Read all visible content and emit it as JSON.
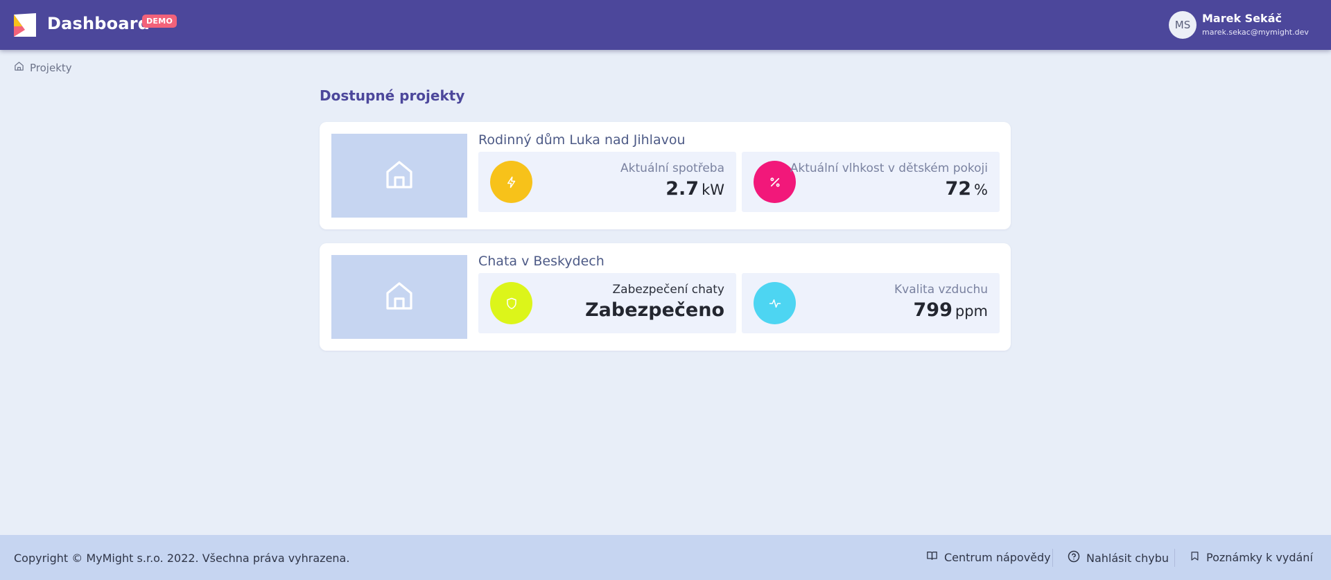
{
  "header": {
    "title": "Dashboard",
    "badge": "DEMO",
    "brand_color": "#4c479b",
    "user": {
      "initials": "MS",
      "name": "Marek Sekáč",
      "email": "marek.sekac@mymight.dev"
    }
  },
  "breadcrumb": {
    "icon": "home-icon",
    "label": "Projekty"
  },
  "main": {
    "title": "Dostupné projekty",
    "projects": [
      {
        "name": "Rodinný dům Luka nad Jihlavou",
        "image_icon": "house-icon",
        "metrics": [
          {
            "label": "Aktuální spotřeba",
            "value": "2.7",
            "unit": "kW",
            "icon": "lightning-icon",
            "color": "#f7c21a"
          },
          {
            "label": "Aktuální vlhkost v dětském pokoji",
            "value": "72",
            "unit": "%",
            "icon": "percent-icon",
            "color": "#f2187a"
          }
        ]
      },
      {
        "name": "Chata v Beskydech",
        "image_icon": "house-icon",
        "metrics": [
          {
            "label": "Zabezpečení chaty",
            "value": "Zabezpečeno",
            "unit": "",
            "icon": "shield-icon",
            "color": "#dcf51a"
          },
          {
            "label": "Kvalita vzduchu",
            "value": "799",
            "unit": "ppm",
            "icon": "activity-icon",
            "color": "#4dd5f2"
          }
        ]
      }
    ]
  },
  "footer": {
    "copyright": "Copyright © MyMight s.r.o. 2022. Všechna práva vyhrazena.",
    "links": [
      {
        "label": "Centrum nápovědy",
        "icon": "book-icon"
      },
      {
        "label": "Nahlásit chybu",
        "icon": "help-circle-icon"
      },
      {
        "label": "Poznámky k vydání",
        "icon": "bookmark-icon"
      }
    ]
  }
}
